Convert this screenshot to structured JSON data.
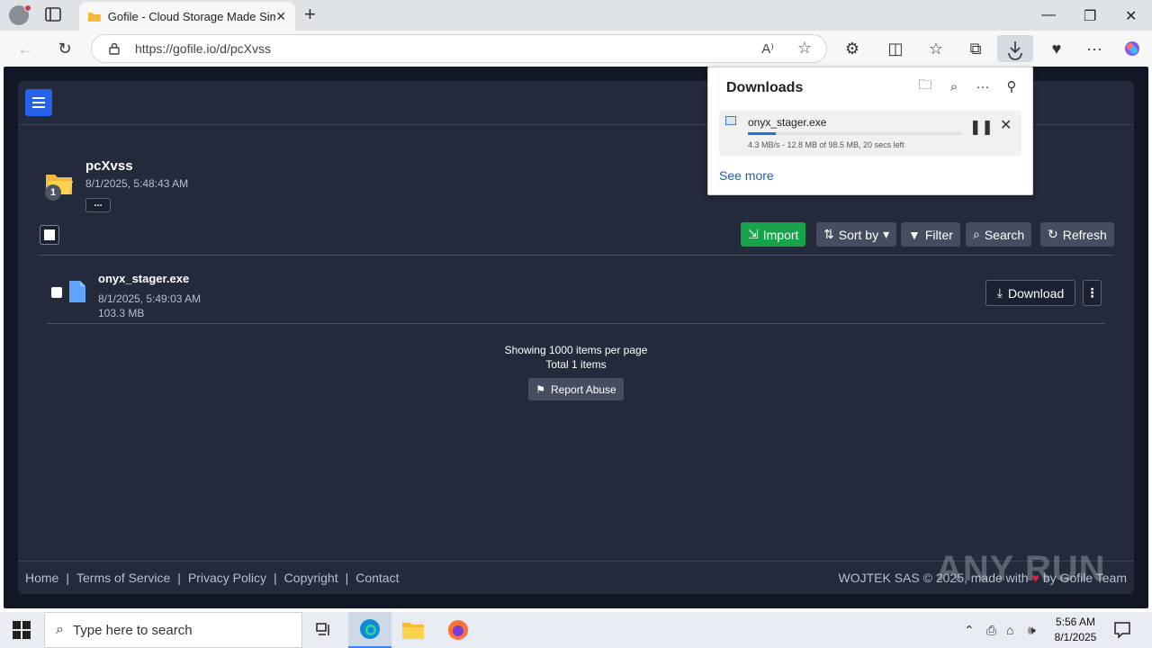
{
  "browser": {
    "tab_title": "Gofile - Cloud Storage Made Simple",
    "url": "https://gofile.io/d/pcXvss"
  },
  "page": {
    "folder": {
      "name": "pcXvss",
      "date": "8/1/2025, 5:48:43 AM",
      "badge_count": "1",
      "more_label": "..."
    },
    "toolbar": {
      "import_label": "Import",
      "sort_label": "Sort by",
      "filter_label": "Filter",
      "search_label": "Search",
      "refresh_label": "Refresh"
    },
    "files": [
      {
        "name": "onyx_stager.exe",
        "date": "8/1/2025, 5:49:03 AM",
        "size": "103.3 MB",
        "download_label": "Download"
      }
    ],
    "summary": {
      "per_page": "Showing 1000 items per page",
      "total": "Total 1 items"
    },
    "report_label": "Report Abuse",
    "footer": {
      "links": [
        "Home",
        "Terms of Service",
        "Privacy Policy",
        "Copyright",
        "Contact"
      ],
      "copyright_prefix": "WOJTEK SAS © 2025, made with",
      "copyright_suffix": "by Gofile Team"
    }
  },
  "downloads": {
    "title": "Downloads",
    "item": {
      "name": "onyx_stager.exe",
      "status": "4.3 MB/s - 12.8 MB of 98.5 MB, 20 secs left",
      "progress": 0.13
    },
    "see_more": "See more"
  },
  "taskbar": {
    "search_placeholder": "Type here to search",
    "time": "5:56 AM",
    "date": "8/1/2025"
  },
  "watermark": "ANY RUN",
  "colors": {
    "page_bg": "#232a3b",
    "accent_blue": "#2563eb",
    "import_green": "#16a34a"
  }
}
